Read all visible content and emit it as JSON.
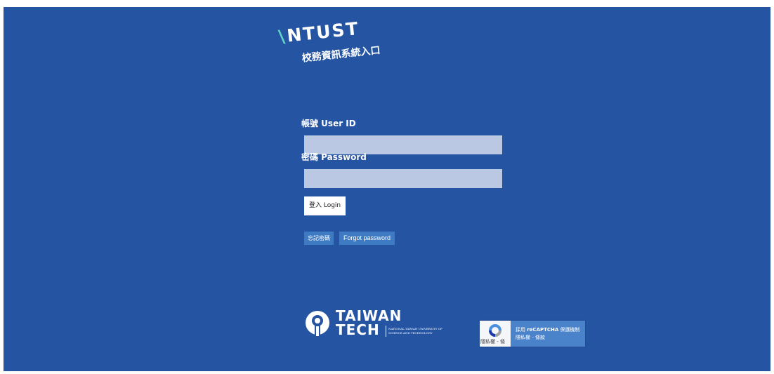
{
  "header": {
    "logo_text": "NTUST",
    "subtitle": "校務資訊系統入口"
  },
  "form": {
    "user_label": "帳號 User ID",
    "user_value": "",
    "password_label": "密碼 Password",
    "password_value": "",
    "login_button": "登入 Login",
    "forgot_zh": "忘記密碼",
    "forgot_en": "Forgot password"
  },
  "footer": {
    "tech_line1": "TAIWAN",
    "tech_line2": "TECH",
    "tech_sub1": "NATIONAL TAIWAN UNIVERSITY OF",
    "tech_sub2": "SCIENCE AND TECHNOLOGY"
  },
  "recaptcha": {
    "line1_prefix": "採用 ",
    "line1_brand": "reCAPTCHA",
    "line1_suffix": " 保護機制",
    "line2": "隱私權 - 條款",
    "privacy_short": "隱私權 - 條"
  },
  "colors": {
    "background": "#2554a3",
    "input_fill": "#bac8e4",
    "secondary_button": "#3e7bc2",
    "logo_accent": "#5fd4c4"
  }
}
